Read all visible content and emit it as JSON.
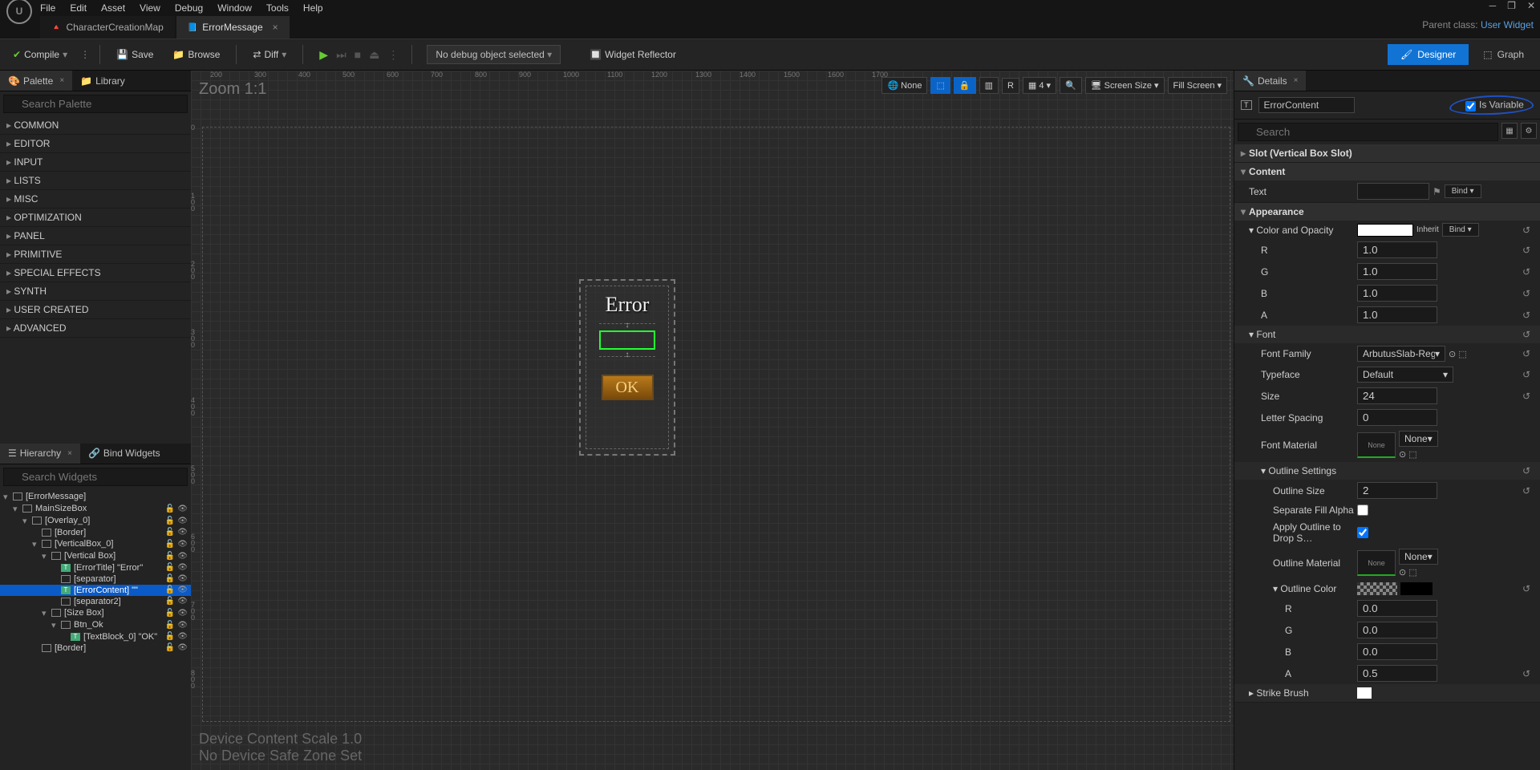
{
  "menu": [
    "File",
    "Edit",
    "Asset",
    "View",
    "Debug",
    "Window",
    "Tools",
    "Help"
  ],
  "tabs": [
    {
      "label": "CharacterCreationMap",
      "active": false,
      "icon": "🔺"
    },
    {
      "label": "ErrorMessage",
      "active": true,
      "icon": "📘"
    }
  ],
  "parent_class_label": "Parent class:",
  "parent_class": "User Widget",
  "toolbar": {
    "compile": "Compile",
    "save": "Save",
    "browse": "Browse",
    "diff": "Diff",
    "debug_selected": "No debug object selected",
    "widget_reflector": "Widget Reflector",
    "designer": "Designer",
    "graph": "Graph"
  },
  "palette": {
    "title": "Palette",
    "lib": "Library",
    "search": "Search Palette",
    "cats": [
      "COMMON",
      "EDITOR",
      "INPUT",
      "LISTS",
      "MISC",
      "OPTIMIZATION",
      "PANEL",
      "PRIMITIVE",
      "SPECIAL EFFECTS",
      "SYNTH",
      "USER CREATED",
      "ADVANCED"
    ]
  },
  "hierarchy": {
    "title": "Hierarchy",
    "bind": "Bind Widgets",
    "search": "Search Widgets",
    "tree": [
      {
        "d": 0,
        "a": "▾",
        "t": "[ErrorMessage]",
        "ic": "w"
      },
      {
        "d": 1,
        "a": "▾",
        "t": "MainSizeBox",
        "ic": "b",
        "eyes": true
      },
      {
        "d": 2,
        "a": "▾",
        "t": "[Overlay_0]",
        "ic": "b",
        "eyes": true
      },
      {
        "d": 3,
        "a": "",
        "t": "[Border]",
        "ic": "b",
        "eyes": true
      },
      {
        "d": 3,
        "a": "▾",
        "t": "[VerticalBox_0]",
        "ic": "b",
        "eyes": true
      },
      {
        "d": 4,
        "a": "▾",
        "t": "[Vertical Box]",
        "ic": "b",
        "eyes": true
      },
      {
        "d": 5,
        "a": "",
        "t": "[ErrorTitle] \"Error\"",
        "ic": "t",
        "eyes": true
      },
      {
        "d": 5,
        "a": "",
        "t": "[separator]",
        "ic": "i",
        "eyes": true
      },
      {
        "d": 5,
        "a": "",
        "t": "[ErrorContent] \"\"",
        "ic": "t",
        "eyes": true,
        "sel": true
      },
      {
        "d": 5,
        "a": "",
        "t": "[separator2]",
        "ic": "i",
        "eyes": true
      },
      {
        "d": 4,
        "a": "▾",
        "t": "[Size Box]",
        "ic": "b",
        "eyes": true
      },
      {
        "d": 5,
        "a": "▾",
        "t": "Btn_Ok",
        "ic": "btn",
        "eyes": true
      },
      {
        "d": 6,
        "a": "",
        "t": "[TextBlock_0] \"OK\"",
        "ic": "t",
        "eyes": true
      },
      {
        "d": 3,
        "a": "",
        "t": "[Border]",
        "ic": "b",
        "eyes": true
      }
    ]
  },
  "canvas": {
    "zoom": "Zoom 1:1",
    "error_title": "Error",
    "ok": "OK",
    "bottom1": "Device Content Scale 1.0",
    "bottom2": "No Device Safe Zone Set",
    "toolbar": {
      "none": "None",
      "r": "R",
      "n": "4",
      "screen": "Screen Size",
      "fill": "Fill Screen"
    },
    "ruler_top": {
      "200": "200",
      "300": "300",
      "400": "400",
      "500": "500",
      "600": "600",
      "700": "700",
      "800": "800",
      "900": "900",
      "1000": "1000",
      "1100": "1100",
      "1200": "1200",
      "1300": "1300",
      "1400": "1400",
      "1500": "1500",
      "1600": "1600",
      "1700": "1700"
    },
    "ruler_left": {
      "0": "0",
      "100": "1 0 0",
      "200": "2 0 0",
      "300": "3 0 0",
      "400": "4 0 0",
      "500": "5 0 0",
      "600": "6 0 0",
      "700": "7 0 0",
      "800": "8 0 0"
    }
  },
  "details": {
    "title": "Details",
    "name": "ErrorContent",
    "is_variable": "Is Variable",
    "search": "Search",
    "sections": {
      "slot": "Slot (Vertical Box Slot)",
      "content": "Content",
      "text": "Text",
      "bind": "Bind",
      "appearance": "Appearance",
      "color_opacity": "Color and Opacity",
      "inherit": "Inherit",
      "r": "R",
      "g": "G",
      "b": "B",
      "a": "A",
      "rv": "1.0",
      "gv": "1.0",
      "bv": "1.0",
      "av": "1.0",
      "font": "Font",
      "font_family": "Font Family",
      "font_family_v": "ArbutusSlab-Regular_Font",
      "typeface": "Typeface",
      "typeface_v": "Default",
      "size": "Size",
      "size_v": "24",
      "letter_spacing": "Letter Spacing",
      "letter_spacing_v": "0",
      "font_material": "Font Material",
      "none": "None",
      "outline": "Outline Settings",
      "outline_size": "Outline Size",
      "outline_size_v": "2",
      "sep_fill": "Separate Fill Alpha",
      "apply_drop": "Apply Outline to Drop S…",
      "outline_mat": "Outline Material",
      "outline_color": "Outline Color",
      "or": "0.0",
      "og": "0.0",
      "ob": "0.0",
      "oa": "0.5",
      "strike": "Strike Brush"
    }
  }
}
